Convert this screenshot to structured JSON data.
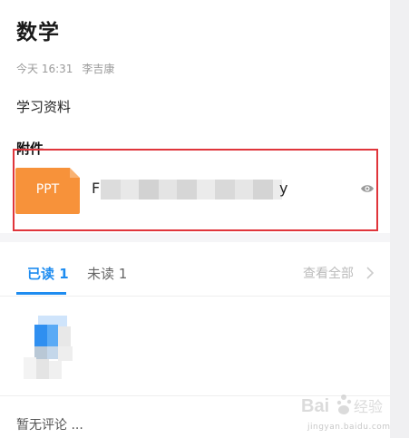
{
  "post": {
    "title": "数学",
    "time": "今天 16:31",
    "author": "李吉康",
    "body": "学习资料"
  },
  "attachments": {
    "heading": "附件",
    "file": {
      "type_label": "PPT",
      "name_start": "F",
      "name_end": "y"
    }
  },
  "read_tabs": {
    "read_label": "已读 1",
    "unread_label": "未读 1",
    "view_all_label": "查看全部"
  },
  "comments": {
    "empty_text": "暂无评论 ..."
  },
  "watermark": {
    "brand": "Bai",
    "brand_cn": "经验",
    "url": "jingyan.baidu.com"
  },
  "colors": {
    "accent": "#1e8cf0",
    "highlight": "#e0353b",
    "ppt": "#f7923a"
  }
}
